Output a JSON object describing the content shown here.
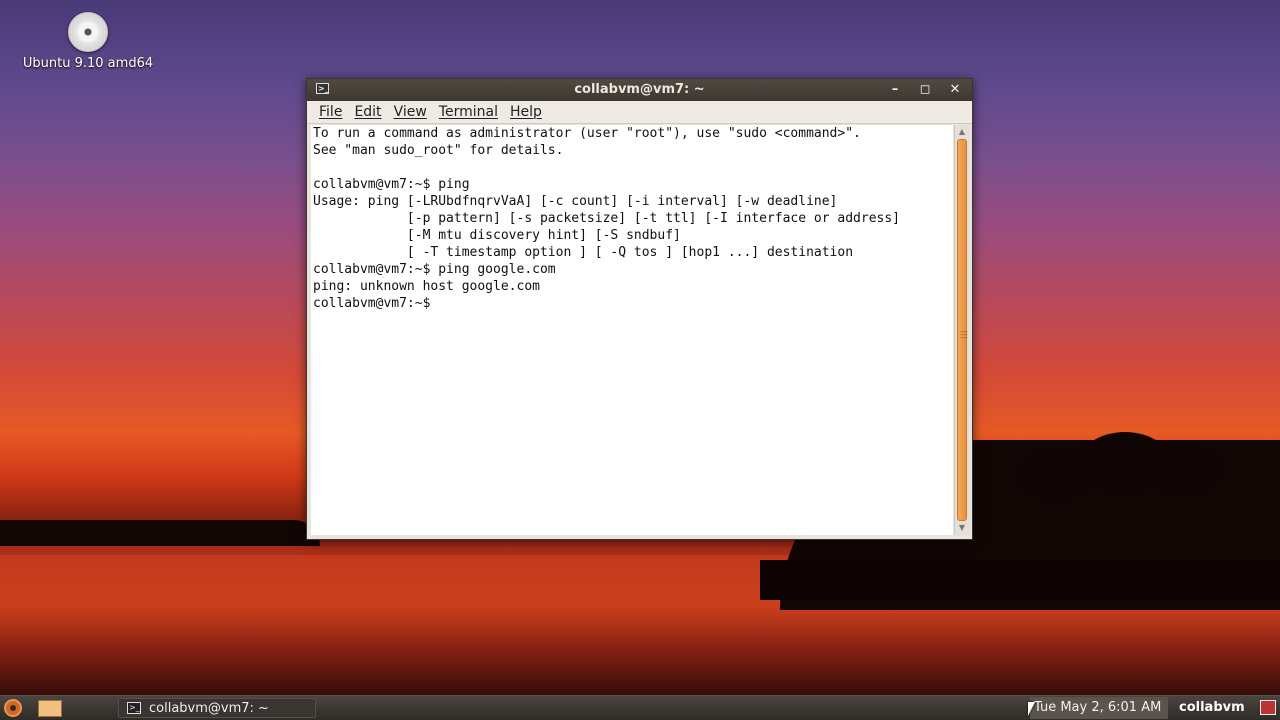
{
  "desktop": {
    "icons": [
      {
        "label": "Ubuntu 9.10 amd64",
        "icon": "cd-icon"
      }
    ]
  },
  "window": {
    "title": "collabvm@vm7: ~",
    "menu": [
      "File",
      "Edit",
      "View",
      "Terminal",
      "Help"
    ]
  },
  "terminal": {
    "lines": [
      "To run a command as administrator (user \"root\"), use \"sudo <command>\".",
      "See \"man sudo_root\" for details.",
      "",
      "collabvm@vm7:~$ ping",
      "Usage: ping [-LRUbdfnqrvVaA] [-c count] [-i interval] [-w deadline]",
      "            [-p pattern] [-s packetsize] [-t ttl] [-I interface or address]",
      "            [-M mtu discovery hint] [-S sndbuf]",
      "            [ -T timestamp option ] [ -Q tos ] [hop1 ...] destination",
      "collabvm@vm7:~$ ping google.com",
      "ping: unknown host google.com",
      "collabvm@vm7:~$"
    ]
  },
  "panel": {
    "task_label": "collabvm@vm7: ~",
    "clock": "Tue May  2,  6:01 AM",
    "user": "collabvm"
  }
}
